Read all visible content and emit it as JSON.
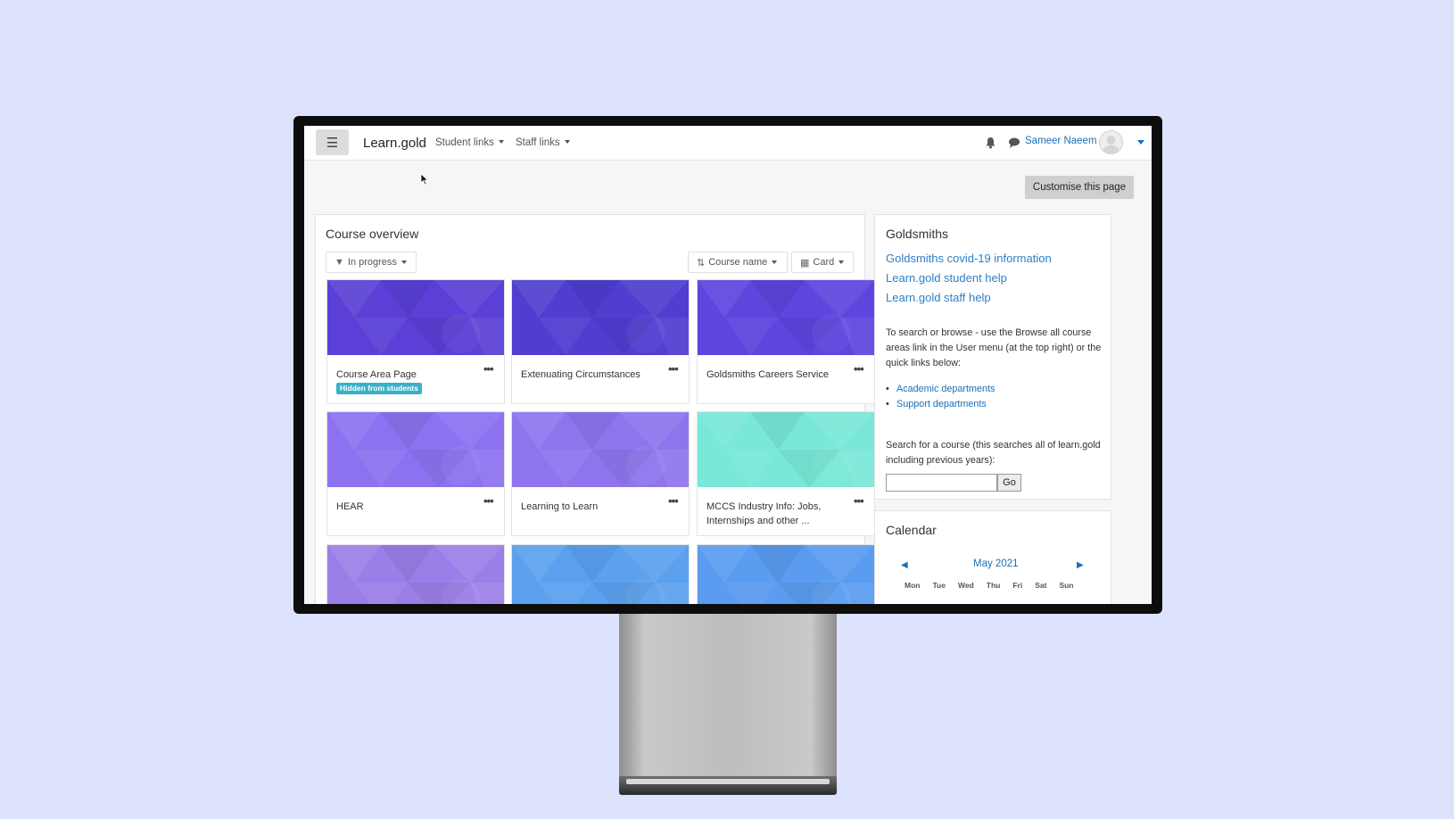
{
  "navbar": {
    "brand": "Learn.gold",
    "student_links": "Student links",
    "staff_links": "Staff links",
    "user_name": "Sameer Naeem",
    "menu_icon": "hamburger-icon",
    "notification_icon": "bell-icon",
    "messages_icon": "chat-icon"
  },
  "customise_label": "Customise this page",
  "overview": {
    "title": "Course overview",
    "filter": "In progress",
    "sort": "Course name",
    "view": "Card",
    "courses": [
      {
        "name": "Course Area Page",
        "badge": "Hidden from students",
        "color": "#5b3fd6"
      },
      {
        "name": "Extenuating Circumstances",
        "color": "#4f3ed0"
      },
      {
        "name": "Goldsmiths Careers Service",
        "color": "#5d45de"
      },
      {
        "name": "HEAR",
        "color": "#8c72f0"
      },
      {
        "name": "Learning to Learn",
        "color": "#8e75ee"
      },
      {
        "name": "MCCS Industry Info: Jobs, Internships and other ...",
        "color": "#79e8d9"
      },
      {
        "name": "",
        "color": "#9b7fe8"
      },
      {
        "name": "",
        "color": "#5ba1ee"
      },
      {
        "name": "",
        "color": "#5a9cf0"
      }
    ]
  },
  "goldsmiths": {
    "title": "Goldsmiths",
    "links": [
      "Goldsmiths covid-19 information",
      "Learn.gold student help",
      "Learn.gold staff help"
    ],
    "browse_text": "To search or browse - use the Browse all course areas link in the User menu (at the top right) or the quick links below:",
    "quick_links": [
      "Academic departments",
      "Support departments"
    ],
    "search_text": "Search for a course (this searches all of learn.gold including previous years):",
    "go_label": "Go"
  },
  "calendar": {
    "title": "Calendar",
    "month": "May 2021",
    "days": [
      "Mon",
      "Tue",
      "Wed",
      "Thu",
      "Fri",
      "Sat",
      "Sun"
    ]
  }
}
